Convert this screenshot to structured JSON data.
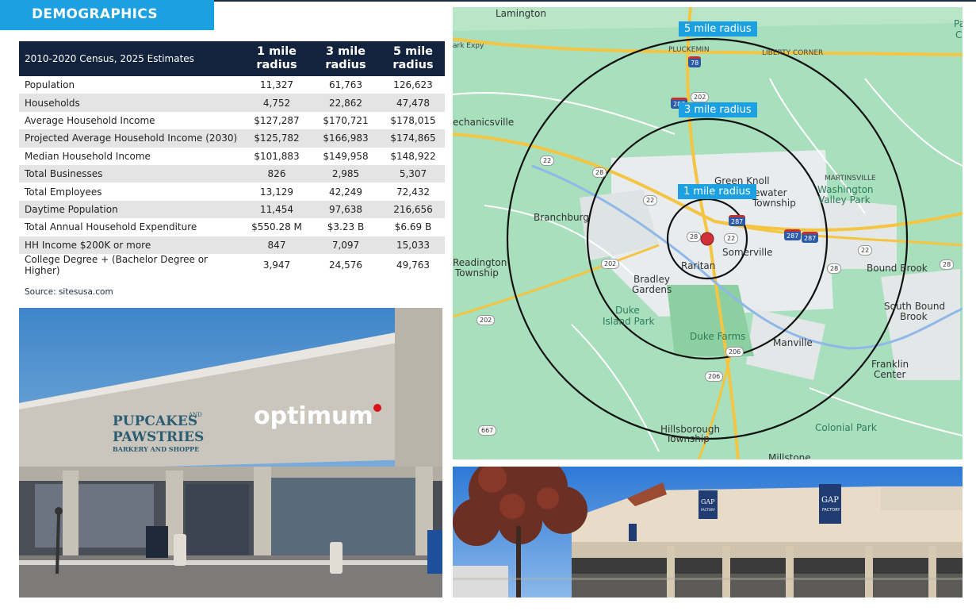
{
  "header": {
    "title": "DEMOGRAPHICS"
  },
  "table": {
    "caption": "2010-2020 Census, 2025 Estimates",
    "col1": "1 mile radius",
    "col2": "3 mile radius",
    "col3": "5 mile radius",
    "rows": [
      {
        "label": "Population",
        "r1": "11,327",
        "r3": "61,763",
        "r5": "126,623"
      },
      {
        "label": "Households",
        "r1": "4,752",
        "r3": "22,862",
        "r5": "47,478"
      },
      {
        "label": "Average Household Income",
        "r1": "$127,287",
        "r3": "$170,721",
        "r5": "$178,015"
      },
      {
        "label": "Projected Average Household Income (2030)",
        "r1": "$125,782",
        "r3": "$166,983",
        "r5": "$174,865"
      },
      {
        "label": "Median Household Income",
        "r1": "$101,883",
        "r3": "$149,958",
        "r5": "$148,922"
      },
      {
        "label": "Total Businesses",
        "r1": "826",
        "r3": "2,985",
        "r5": "5,307"
      },
      {
        "label": "Total Employees",
        "r1": "13,129",
        "r3": "42,249",
        "r5": "72,432"
      },
      {
        "label": "Daytime Population",
        "r1": "11,454",
        "r3": "97,638",
        "r5": "216,656"
      },
      {
        "label": "Total Annual Household Expenditure",
        "r1": "$550.28 M",
        "r3": "$3.23 B",
        "r5": "$6.69 B"
      },
      {
        "label": "HH Income $200K or more",
        "r1": "847",
        "r3": "7,097",
        "r5": "15,033"
      },
      {
        "label": "College Degree + (Bachelor Degree or Higher)",
        "r1": "3,947",
        "r3": "24,576",
        "r5": "49,763"
      }
    ],
    "source": "Source: sitesusa.com"
  },
  "photo1": {
    "sign1_line1": "PUPCAKES",
    "sign1_amp": "AND",
    "sign1_line2": "PAWSTRIES",
    "sign1_line3": "BARKERY AND SHOPPE",
    "sign2": "optimum"
  },
  "photo2": {
    "sign_text": "GAP",
    "sign_sub": "FACTORY"
  },
  "map": {
    "radius_labels": {
      "five": "5 mile radius",
      "three": "3 mile radius",
      "one": "1 mile radius"
    },
    "places": [
      "Lamington",
      "PLUCKEMIN",
      "LIBERTY CORNER",
      "echanicsville",
      "Green Knoll",
      "ewater",
      "Township",
      "MARTINSVILLE",
      "Washington",
      "Valley Park",
      "Branchburg",
      "Somerville",
      "Raritan",
      "Readington",
      "Township",
      "Bradley",
      "Gardens",
      "Bound Brook",
      "Duke",
      "Island Park",
      "Duke Farms",
      "South Bound",
      "Brook",
      "Manville",
      "Franklin",
      "Center",
      "Hillsborough",
      "Township",
      "Colonial Park",
      "Millstone",
      "ark Expy",
      "Pa",
      "C"
    ],
    "shields": [
      "78",
      "202",
      "287",
      "22",
      "28",
      "22",
      "287",
      "22",
      "28",
      "202",
      "287",
      "287",
      "22",
      "28",
      "28",
      "202",
      "206",
      "206",
      "667"
    ]
  }
}
